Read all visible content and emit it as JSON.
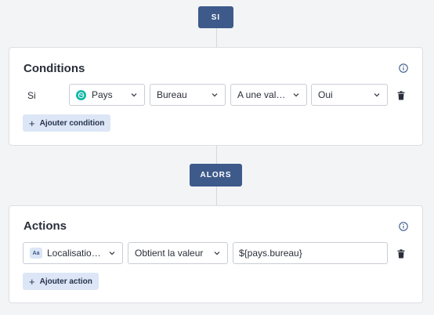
{
  "if_pill": {
    "label": "SI"
  },
  "then_pill": {
    "label": "ALORS"
  },
  "conditions": {
    "title": "Conditions",
    "row_label": "Si",
    "field_select": {
      "value": "Pays",
      "icon": "globe-icon"
    },
    "property_select": {
      "value": "Bureau"
    },
    "operator_select": {
      "value": "A une valeur"
    },
    "value_select": {
      "value": "Oui"
    },
    "add_label": "Ajouter condition"
  },
  "actions": {
    "title": "Actions",
    "target_select": {
      "value": "Localisation b...",
      "icon": "text-type-icon",
      "icon_text": "Aa"
    },
    "action_select": {
      "value": "Obtient la valeur"
    },
    "value_input": {
      "value": "${pays.bureau}"
    },
    "add_label": "Ajouter action"
  },
  "colors": {
    "pill": "#3d5a8a",
    "add_button_bg": "#dce6f6",
    "globe_badge": "#14b8a6"
  }
}
